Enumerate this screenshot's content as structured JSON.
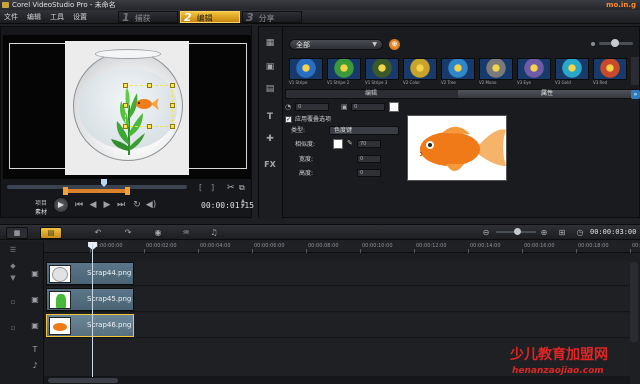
{
  "window": {
    "title": "Corel VideoStudio Pro - 未命名",
    "brand": "mo.in.g"
  },
  "menu": {
    "items": [
      "文件",
      "编辑",
      "工具",
      "设置"
    ]
  },
  "steps": [
    {
      "num": "1",
      "label": "捕获",
      "active": false
    },
    {
      "num": "2",
      "label": "编辑",
      "active": true
    },
    {
      "num": "3",
      "label": "分享",
      "active": false
    }
  ],
  "preview": {
    "project_label": "项目",
    "clip_label": "素材",
    "timecode": "00:00:01:15"
  },
  "library": {
    "gallery_value": "全部",
    "thumbnails": [
      {
        "caption": "V1 Stripe",
        "color": "#2a6fc4"
      },
      {
        "caption": "V1 Stripe 2",
        "color": "#3b9a3a"
      },
      {
        "caption": "V1 Stripe 3",
        "color": "#3a5a2a"
      },
      {
        "caption": "V2 Color",
        "color": "#c9a42a"
      },
      {
        "caption": "V2 Tree",
        "color": "#2f86c9"
      },
      {
        "caption": "V2 Mono",
        "color": "#7a7a7a"
      },
      {
        "caption": "V3 Eye",
        "color": "#6f5aa8"
      },
      {
        "caption": "V3 Gold",
        "color": "#2aa8c9"
      },
      {
        "caption": "V3 Red",
        "color": "#c94a2a"
      }
    ],
    "tab_edit": "编辑",
    "tab_attributes": "属性",
    "attributes": {
      "rotation_value": "0",
      "second_value": "0",
      "apply_overlay_label": "应用覆叠选项",
      "type_label": "类型:",
      "type_value": "色度键",
      "similarity_label": "相似度:",
      "similarity_value": "70",
      "width_label": "宽度:",
      "width_value": "0",
      "height_label": "高度:",
      "height_value": "0"
    }
  },
  "timeline": {
    "duration": "00:00:03:00",
    "ruler": [
      "00:00:00:00",
      "00:00:02:00",
      "00:00:04:00",
      "00:00:06:00",
      "00:00:08:00",
      "00:00:10:00",
      "00:00:12:00",
      "00:00:14:00",
      "00:00:16:00",
      "00:00:18:00",
      "00:00:20:00"
    ],
    "clips": [
      {
        "label": "Scrap44.png",
        "selected": false
      },
      {
        "label": "Scrap45.png",
        "selected": false
      },
      {
        "label": "Scrap46.png",
        "selected": true
      }
    ]
  },
  "watermark": {
    "line1": "少儿教育加盟网",
    "line2": "henanzaojiao.com"
  },
  "colors": {
    "accent": "#f3c33c",
    "clip": "#5b7688",
    "watermark": "#e02525"
  }
}
